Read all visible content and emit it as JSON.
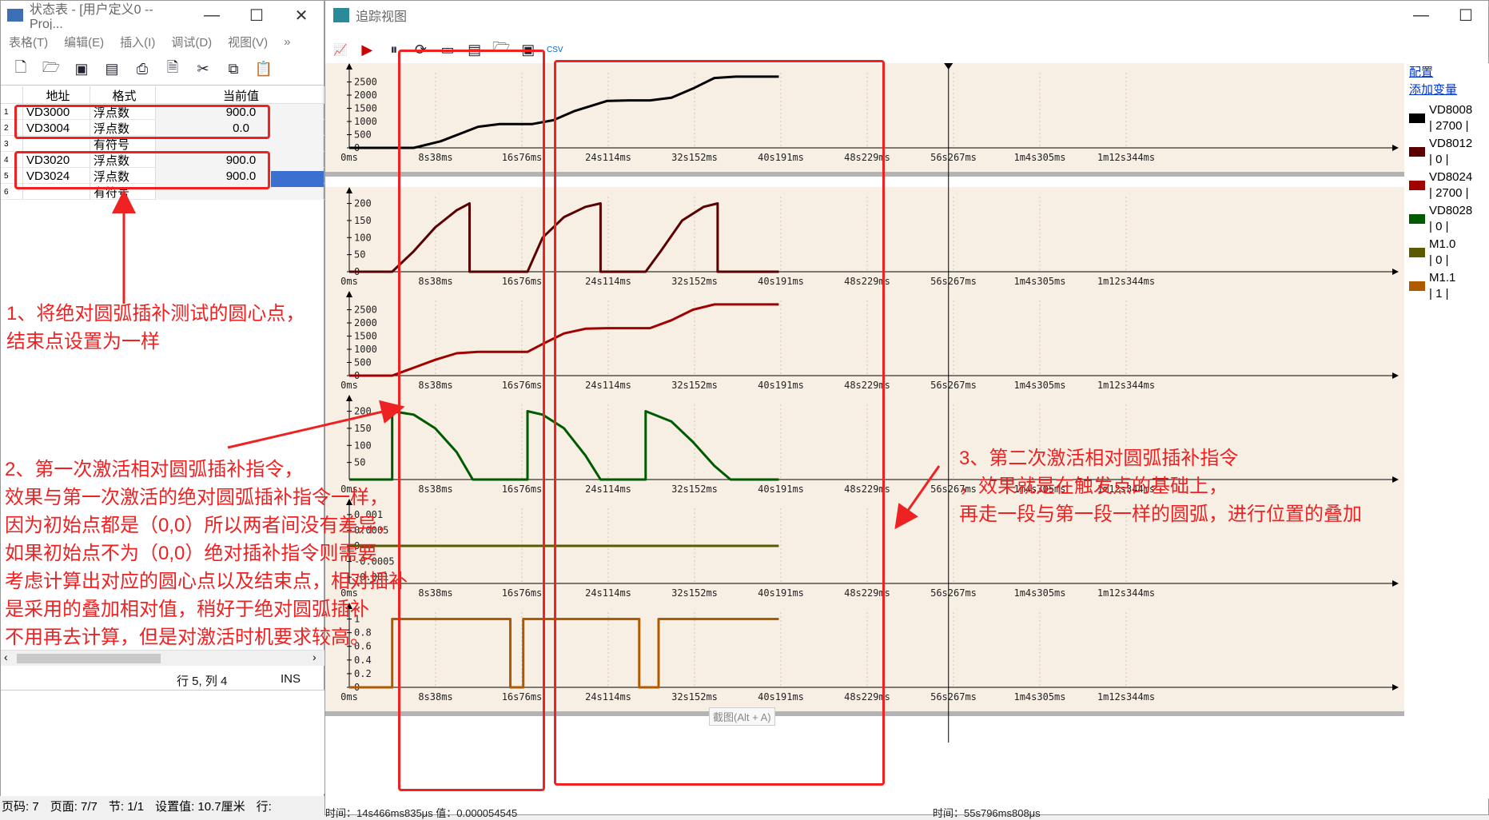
{
  "left_window": {
    "title": "状态表 - [用户定义0 -- Proj...",
    "menu": [
      "表格(T)",
      "编辑(E)",
      "插入(I)",
      "调试(D)",
      "视图(V)",
      "»"
    ],
    "columns": [
      "地址",
      "格式",
      "当前值"
    ],
    "rows": [
      {
        "idx": "1",
        "addr": "VD3000",
        "fmt": "浮点数",
        "val": "900.0"
      },
      {
        "idx": "2",
        "addr": "VD3004",
        "fmt": "浮点数",
        "val": "0.0"
      },
      {
        "idx": "3",
        "addr": "",
        "fmt": "有符号",
        "val": ""
      },
      {
        "idx": "4",
        "addr": "VD3020",
        "fmt": "浮点数",
        "val": "900.0"
      },
      {
        "idx": "5",
        "addr": "VD3024",
        "fmt": "浮点数",
        "val": "900.0"
      },
      {
        "idx": "6",
        "addr": "",
        "fmt": "有符号",
        "val": ""
      }
    ],
    "status_row_col": "行 5, 列 4",
    "status_ins": "INS"
  },
  "doc_status": {
    "page_code": "页码: 7",
    "page": "页面: 7/7",
    "section": "节: 1/1",
    "setting": "设置值: 10.7厘米",
    "row": "行:"
  },
  "right_window": {
    "title": "追踪视图",
    "links": {
      "config": "配置",
      "add_var": "添加变量"
    },
    "legend": [
      {
        "name": "VD8008",
        "value": "| 2700 |",
        "color": "#000000"
      },
      {
        "name": "VD8012",
        "value": "| 0 |",
        "color": "#5a0000"
      },
      {
        "name": "VD8024",
        "value": "| 2700 |",
        "color": "#a00000"
      },
      {
        "name": "VD8028",
        "value": "| 0 |",
        "color": "#005a00"
      },
      {
        "name": "M1.0",
        "value": "| 0 |",
        "color": "#5a5a00"
      },
      {
        "name": "M1.1",
        "value": "| 1 |",
        "color": "#b05a00"
      }
    ],
    "time_labels": [
      "0ms",
      "8s38ms",
      "16s76ms",
      "24s114ms",
      "32s152ms",
      "40s191ms",
      "48s229ms",
      "56s267ms",
      "1m4s305ms",
      "1m12s344ms"
    ],
    "tooltip": "截图(Alt + A)",
    "footer_left": "时间：14s466ms835μs    值：0.000054545",
    "footer_right": "时间：55s796ms808μs"
  },
  "chart_data": [
    {
      "type": "line",
      "name": "VD8008",
      "color": "#000000",
      "yticks": [
        "2500",
        "2000",
        "1500",
        "1000",
        "500",
        "0"
      ],
      "ylim": [
        0,
        2850
      ],
      "x": [
        0,
        6,
        8.5,
        12,
        14,
        16,
        17,
        19,
        21,
        24,
        26,
        28,
        30,
        32,
        34,
        36,
        38,
        40
      ],
      "y": [
        0,
        0,
        250,
        800,
        900,
        900,
        900,
        1050,
        1400,
        1780,
        1800,
        1800,
        1900,
        2250,
        2650,
        2700,
        2700,
        2700
      ]
    },
    {
      "type": "line",
      "name": "VD8012",
      "color": "#5a0000",
      "yticks": [
        "200",
        "150",
        "100",
        "50",
        "0"
      ],
      "ylim": [
        0,
        220
      ],
      "x": [
        0,
        4,
        6,
        8,
        10,
        11.2,
        11.2,
        12,
        16,
        16.6,
        18,
        20,
        22,
        23.4,
        23.4,
        24,
        27.6,
        29,
        31,
        33,
        34.3,
        34.3,
        35,
        40
      ],
      "y": [
        0,
        0,
        60,
        130,
        180,
        200,
        0,
        0,
        0,
        0,
        100,
        160,
        190,
        200,
        0,
        0,
        0,
        60,
        150,
        190,
        200,
        0,
        0,
        0
      ]
    },
    {
      "type": "line",
      "name": "VD8024",
      "color": "#a00000",
      "yticks": [
        "2500",
        "2000",
        "1500",
        "1000",
        "500",
        "0"
      ],
      "ylim": [
        0,
        2850
      ],
      "x": [
        0,
        4,
        6,
        8,
        10,
        12,
        14,
        16,
        16.6,
        18,
        20,
        22,
        24,
        26,
        28,
        30,
        32,
        34,
        36,
        38,
        40
      ],
      "y": [
        0,
        0,
        300,
        600,
        850,
        900,
        900,
        900,
        900,
        1200,
        1600,
        1780,
        1800,
        1800,
        1800,
        2100,
        2500,
        2700,
        2700,
        2700,
        2700
      ]
    },
    {
      "type": "line",
      "name": "VD8028",
      "color": "#005a00",
      "yticks": [
        "200",
        "150",
        "100",
        "50"
      ],
      "ylim": [
        0,
        220
      ],
      "x": [
        0,
        4,
        4,
        6,
        8,
        10,
        11.5,
        16,
        16.6,
        16.6,
        18,
        20,
        22,
        23.4,
        27.6,
        27.6,
        30,
        32,
        34,
        35.5,
        40
      ],
      "y": [
        0,
        0,
        200,
        190,
        150,
        80,
        0,
        0,
        0,
        200,
        190,
        150,
        70,
        0,
        0,
        200,
        170,
        110,
        40,
        0,
        0
      ]
    },
    {
      "type": "line",
      "name": "M1.0",
      "color": "#5a5a00",
      "yticks": [
        "0.001",
        "0.0005",
        "0",
        "-0.0005",
        "-0.001"
      ],
      "ylim": [
        -0.0012,
        0.0012
      ],
      "x": [
        0,
        40
      ],
      "y": [
        0,
        0
      ]
    },
    {
      "type": "line",
      "name": "M1.1",
      "color": "#b05a00",
      "yticks": [
        "1",
        "0.8",
        "0.6",
        "0.4",
        "0.2",
        "0"
      ],
      "ylim": [
        0,
        1.1
      ],
      "x": [
        0,
        4,
        4,
        15,
        15,
        16.2,
        16.2,
        27,
        27,
        28.8,
        28.8,
        40
      ],
      "y": [
        0,
        0,
        1,
        1,
        0,
        0,
        1,
        1,
        0,
        0,
        1,
        1
      ]
    }
  ],
  "annotations": {
    "a1_line1": "1、将绝对圆弧插补测试的圆心点，",
    "a1_line2": "结束点设置为一样",
    "a2_line1": "2、第一次激活相对圆弧插补指令，",
    "a2_line2": "效果与第一次激活的绝对圆弧插补指令一样，",
    "a2_line3": "因为初始点都是（0,0）所以两者间没有差异，",
    "a2_line4": "如果初始点不为（0,0）绝对插补指令则需要",
    "a2_line5": "考虑计算出对应的圆心点以及结束点，相对插补",
    "a2_line6": "是采用的叠加相对值，稍好于绝对圆弧插补",
    "a2_line7": "不用再去计算，但是对激活时机要求较高。",
    "a3_line1": "3、第二次激活相对圆弧插补指令",
    "a3_line2": "，效果就是在触发点的基础上，",
    "a3_line3": "再走一段与第一段一样的圆弧，进行位置的叠加"
  }
}
